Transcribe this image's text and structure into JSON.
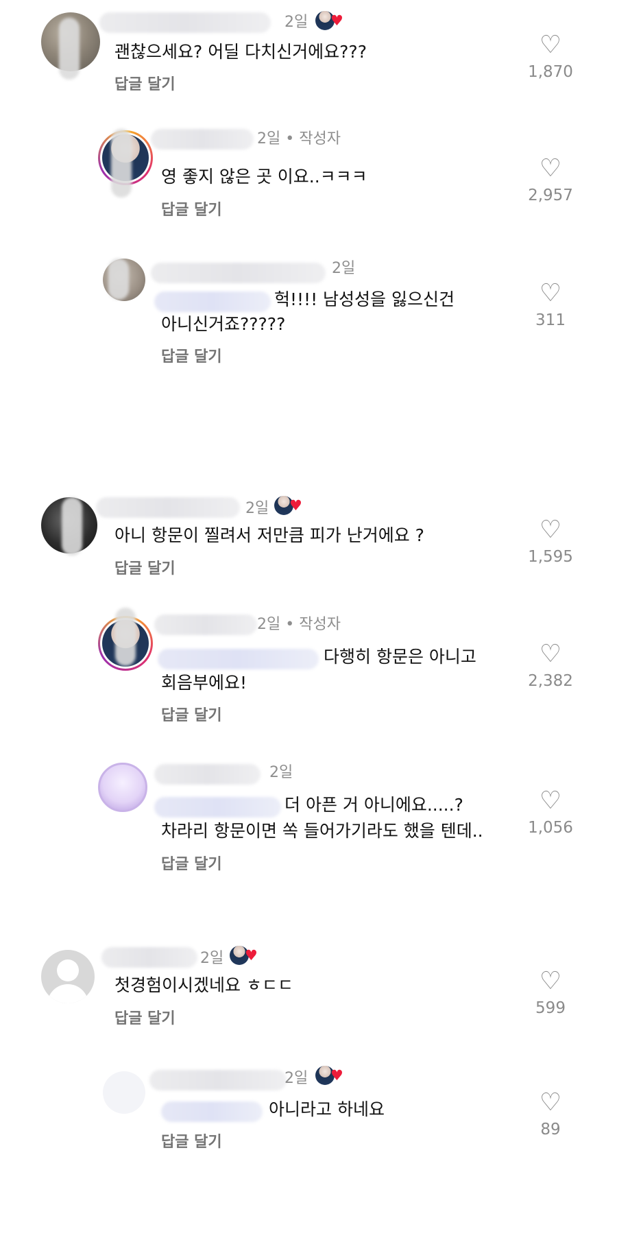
{
  "reply_label": "답글 달기",
  "author_label": "작성자",
  "colors": {
    "like_heart_badge": "#ed1c3a",
    "meta_gray": "#8e8e8e"
  },
  "icons": {
    "like": "heart-outline-icon",
    "creator_like": "creator-heart-icon"
  },
  "comments": [
    {
      "time": "2일",
      "text": "괜찮으세요? 어딜 다치신거에요???",
      "likes": "1,870"
    },
    {
      "time": "2일",
      "text": "영 좋지 않은 곳 이요..ㅋㅋㅋ",
      "likes": "2,957",
      "is_author": true
    },
    {
      "time": "2일",
      "text_line1": "헉!!!! 남성성을 잃으신건",
      "text_line2": "아니신거죠?????",
      "likes": "311"
    },
    {
      "time": "2일",
      "text": "아니 항문이 찔려서 저만큼 피가 난거에요 ?",
      "likes": "1,595"
    },
    {
      "time": "2일",
      "text_line1": "다행히 항문은 아니고",
      "text_line2": "회음부에요!",
      "likes": "2,382",
      "is_author": true
    },
    {
      "time": "2일",
      "text_line1": "더 아픈 거 아니에요.....?",
      "text_line2": "차라리 항문이면 쏙 들어가기라도 했을 텐데..",
      "likes": "1,056"
    },
    {
      "time": "2일",
      "text": "첫경험이시겠네요 ㅎㄷㄷ",
      "likes": "599"
    },
    {
      "time": "2일",
      "text": "아니라고 하네요",
      "likes": "89"
    }
  ]
}
